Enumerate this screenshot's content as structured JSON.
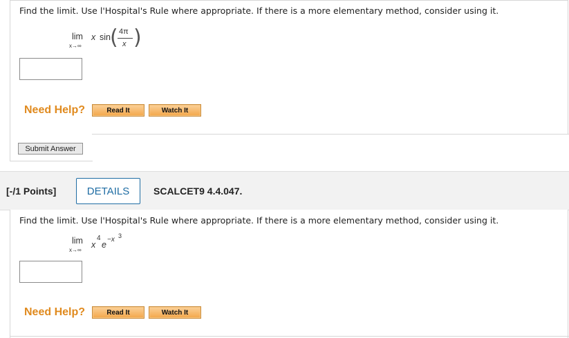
{
  "problem1": {
    "prompt": "Find the limit. Use l'Hospital's Rule where appropriate. If there is a more elementary method, consider using it.",
    "lim": "lim",
    "lim_sub": "x→∞",
    "x": "x",
    "func": "sin",
    "frac_num": "4π",
    "frac_den": "x",
    "answer_value": "",
    "need_help": "Need Help?",
    "read_it": "Read It",
    "watch_it": "Watch It",
    "submit": "Submit Answer"
  },
  "problem2_header": {
    "points": "[-/1 Points]",
    "details": "DETAILS",
    "code": "SCALCET9 4.4.047."
  },
  "problem2": {
    "prompt": "Find the limit. Use l'Hospital's Rule where appropriate. If there is a more elementary method, consider using it.",
    "lim": "lim",
    "lim_sub": "x→∞",
    "base_x": "x",
    "exp4": "4",
    "e": "e",
    "exp_neg": "−x",
    "exp3": "3",
    "answer_value": "",
    "need_help": "Need Help?",
    "read_it": "Read It",
    "watch_it": "Watch It"
  },
  "colors": {
    "help_orange": "#e08a1e",
    "details_blue": "#1e6ca3",
    "band_gray": "#f2f2f2"
  }
}
